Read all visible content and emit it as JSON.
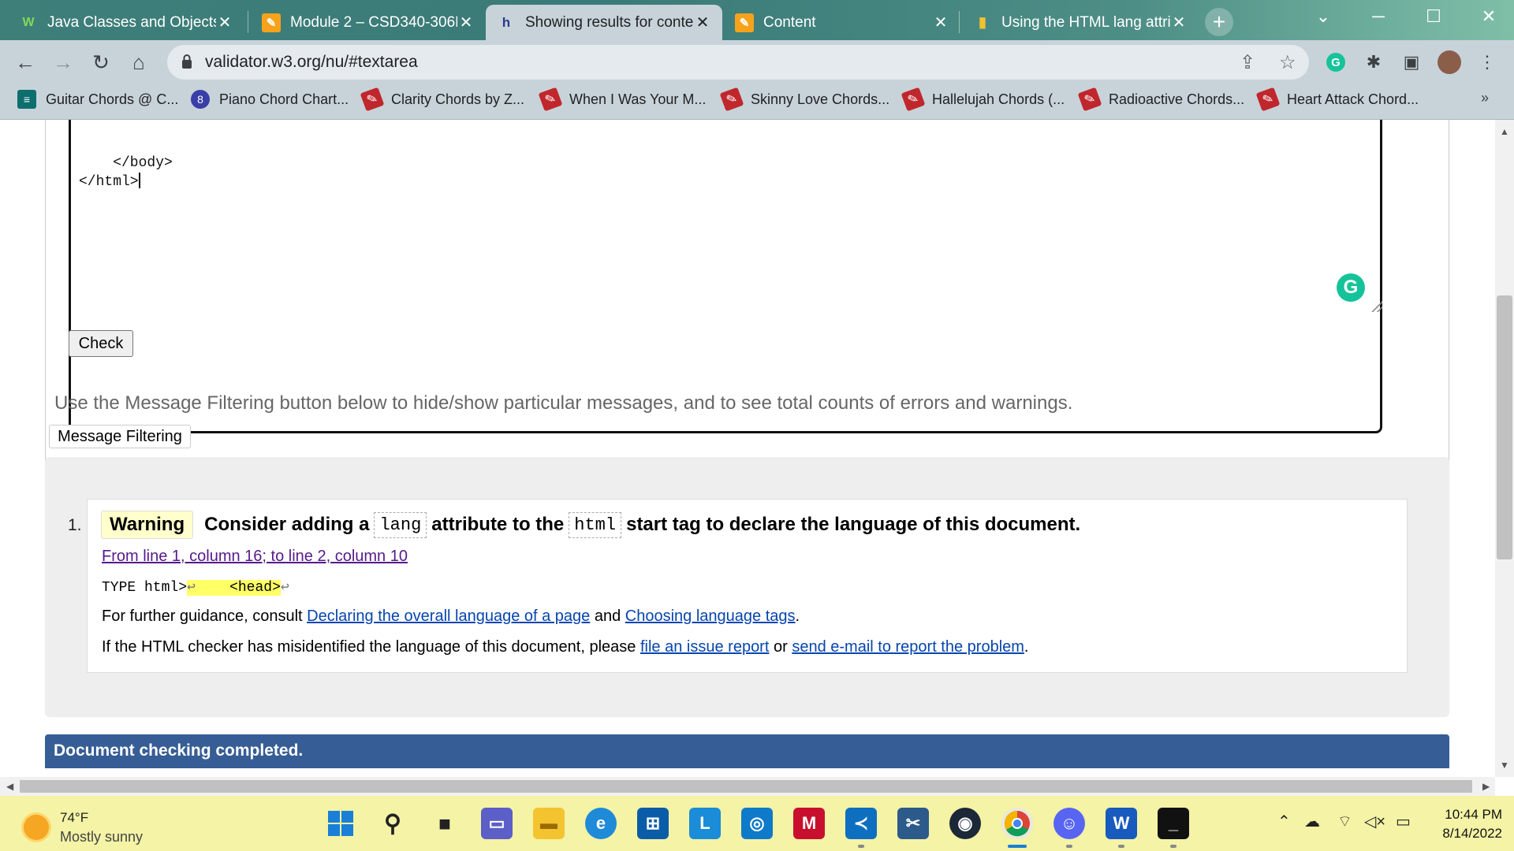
{
  "browser": {
    "tabs": [
      {
        "title": "Java Classes and Objects",
        "icon": "w-icon"
      },
      {
        "title": "Module 2 – CSD340-306H",
        "icon": "pencil-icon"
      },
      {
        "title": "Showing results for conte",
        "icon": "validator-icon",
        "active": true
      },
      {
        "title": "Content",
        "icon": "pencil-icon"
      },
      {
        "title": "Using the HTML lang attri",
        "icon": "w3schools-icon"
      }
    ],
    "url": "validator.w3.org/nu/#textarea",
    "bookmarks": [
      "Guitar Chords @ C...",
      "Piano Chord Chart...",
      "Clarity Chords by Z...",
      "When I Was Your M...",
      "Skinny Love Chords...",
      "Hallelujah Chords (...",
      "Radioactive Chords...",
      "Heart Attack Chord..."
    ],
    "bookmarks_overflow": "»"
  },
  "page": {
    "textarea_line1": "    </body>",
    "textarea_line2": "</html>",
    "check_button": "Check",
    "filter_hint": "Use the Message Filtering button below to hide/show particular messages, and to see total counts of errors and warnings.",
    "filter_button": "Message Filtering",
    "message": {
      "number": "1.",
      "type": "Warning",
      "text_a": "Consider adding a",
      "code_1": "lang",
      "text_b": "attribute to the",
      "code_2": "html",
      "text_c": "start tag to declare the language of this document.",
      "location": "From line 1, column 16; to line 2, column 10",
      "extract_pre": "TYPE html>",
      "extract_hl_lf": "↩",
      "extract_hl_text": "    <head>",
      "extract_post_lf": "↩",
      "guidance_a": "For further guidance, consult",
      "guidance_link1": "Declaring the overall language of a page",
      "guidance_and": "and",
      "guidance_link2": "Choosing language tags",
      "guidance_end": ".",
      "misid_a": "If the HTML checker has misidentified the language of this document, please",
      "misid_link1": "file an issue report",
      "misid_or": "or",
      "misid_link2": "send e-mail to report the problem",
      "misid_end": "."
    },
    "status": "Document checking completed."
  },
  "taskbar": {
    "weather_temp": "74°F",
    "weather_desc": "Mostly sunny",
    "time": "10:44 PM",
    "date": "8/14/2022"
  },
  "colors": {
    "tabstrip": "#3f7f7a",
    "toolbar": "#c8d3d9",
    "status_bar": "#365d95",
    "taskbar": "#f4f3a6",
    "warning_bg": "#ffffcc"
  }
}
